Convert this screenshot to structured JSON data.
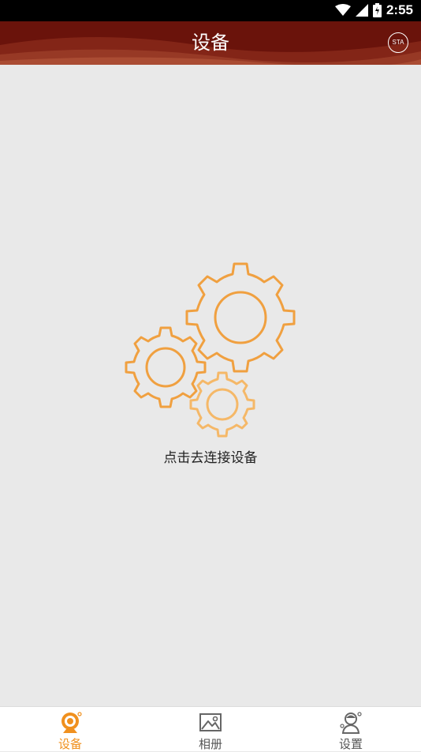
{
  "status_bar": {
    "time": "2:55",
    "icons": [
      "wifi-icon",
      "signal-icon",
      "battery-icon"
    ]
  },
  "app_bar": {
    "title": "设备",
    "sta_label": "STA"
  },
  "main": {
    "empty_icon": "gears-icon",
    "connect_text": "点击去连接设备"
  },
  "tabs": [
    {
      "label": "设备",
      "icon": "camera-icon",
      "active": true
    },
    {
      "label": "相册",
      "icon": "image-icon",
      "active": false
    },
    {
      "label": "设置",
      "icon": "user-settings-icon",
      "active": false
    }
  ],
  "colors": {
    "accent": "#f0901e",
    "header": "#7a1a10",
    "background": "#e9e9e9"
  }
}
